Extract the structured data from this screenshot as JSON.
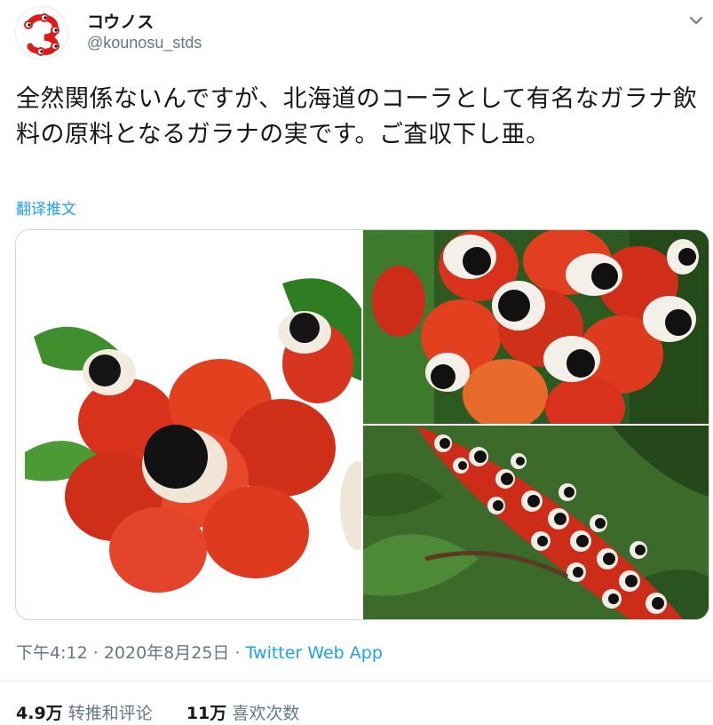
{
  "user": {
    "display_name": "コウノス",
    "handle": "@kounosu_stds"
  },
  "tweet": {
    "text": "全然関係ないんですが、北海道のコーラとして有名なガラナ飲料の原料となるガラナの実です。ご査収下し亜。",
    "translate_link": "翻译推文"
  },
  "media": {
    "count": 3,
    "icons": [
      "guarana-fruit-cluster-photo",
      "guarana-closeup-photo",
      "guarana-plant-photo"
    ]
  },
  "meta": {
    "time": "下午4:12",
    "separator": "·",
    "date": "2020年8月25日",
    "source": "Twitter Web App"
  },
  "stats": {
    "retweets_count": "4.9万",
    "retweets_label": "转推和评论",
    "likes_count": "11万",
    "likes_label": "喜欢次数"
  },
  "colors": {
    "link": "#1da1f2",
    "secondary_text": "#657786",
    "border": "#e6ecf0",
    "fruit_red": "#d8321c"
  }
}
